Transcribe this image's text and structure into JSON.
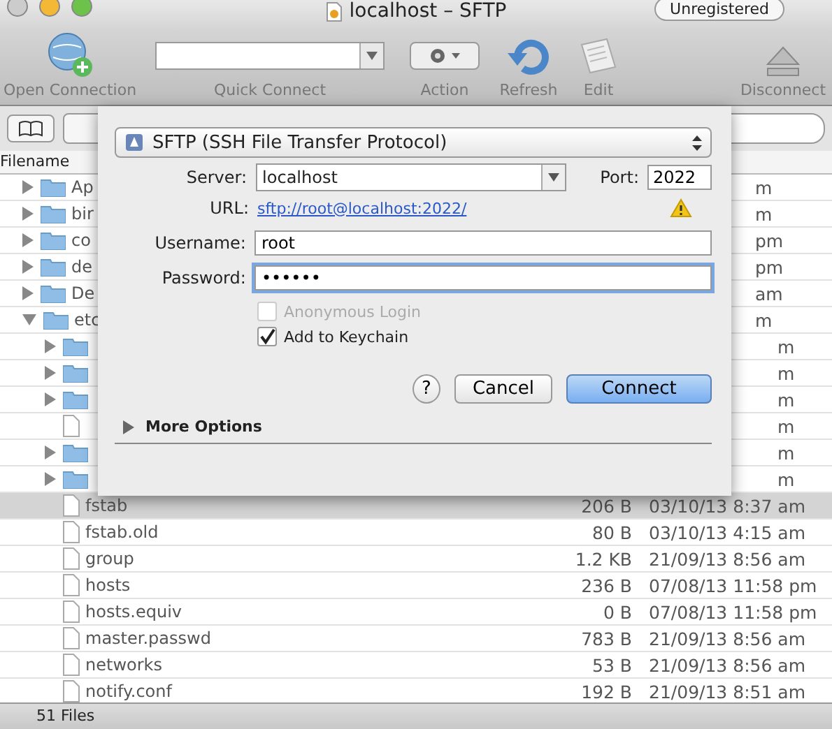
{
  "window": {
    "title": "localhost – SFTP",
    "badge": "Unregistered"
  },
  "toolbar": [
    {
      "kind": "globe",
      "label": "Open Connection"
    },
    {
      "kind": "combo",
      "label": "Quick Connect"
    },
    {
      "kind": "action",
      "label": "Action"
    },
    {
      "kind": "refresh",
      "label": "Refresh"
    },
    {
      "kind": "edit",
      "label": "Edit"
    },
    {
      "kind": "eject",
      "label": "Disconnect"
    }
  ],
  "list_header": "Filename",
  "files": [
    {
      "kind": "folder",
      "name": "Ap",
      "modified": "m",
      "expanded": false,
      "selected": false
    },
    {
      "kind": "folder",
      "name": "bir",
      "modified": "m",
      "expanded": false,
      "selected": false
    },
    {
      "kind": "folder",
      "name": "co",
      "modified": "pm",
      "expanded": false,
      "selected": false
    },
    {
      "kind": "folder",
      "name": "de",
      "modified": "pm",
      "expanded": false,
      "selected": false
    },
    {
      "kind": "folder",
      "name": "De",
      "modified": "am",
      "expanded": false,
      "selected": false
    },
    {
      "kind": "folder",
      "name": "etc",
      "modified": "m",
      "expanded": true,
      "selected": false,
      "children": [
        {
          "kind": "folder",
          "modified": "m",
          "expanded": false,
          "selected": false
        },
        {
          "kind": "folder",
          "modified": "m",
          "expanded": false,
          "selected": false
        },
        {
          "kind": "folder",
          "modified": "m",
          "expanded": false,
          "selected": false
        },
        {
          "kind": "file",
          "modified": "m",
          "selected": false
        },
        {
          "kind": "folder",
          "modified": "m",
          "expanded": false,
          "selected": false
        },
        {
          "kind": "folder",
          "modified": "m",
          "expanded": false,
          "selected": false
        },
        {
          "kind": "file",
          "name": "fstab",
          "size": "206 B",
          "modified": "03/10/13 8:37 am",
          "selected": true
        },
        {
          "kind": "file",
          "name": "fstab.old",
          "size": "80 B",
          "modified": "03/10/13 4:15 am",
          "selected": false
        },
        {
          "kind": "file",
          "name": "group",
          "size": "1.2 KB",
          "modified": "21/09/13 8:56 am",
          "selected": false
        },
        {
          "kind": "file",
          "name": "hosts",
          "size": "236 B",
          "modified": "07/08/13 11:58 pm",
          "selected": false
        },
        {
          "kind": "file",
          "name": "hosts.equiv",
          "size": "0 B",
          "modified": "07/08/13 11:58 pm",
          "selected": false
        },
        {
          "kind": "file",
          "name": "master.passwd",
          "size": "783 B",
          "modified": "21/09/13 8:56 am",
          "selected": false
        },
        {
          "kind": "file",
          "name": "networks",
          "size": "53 B",
          "modified": "21/09/13 8:56 am",
          "selected": false
        },
        {
          "kind": "file",
          "name": "notify.conf",
          "size": "192 B",
          "modified": "21/09/13 8:51 am",
          "selected": false
        }
      ]
    }
  ],
  "status_bar": "51 Files",
  "sheet": {
    "protocol": "SFTP (SSH File Transfer Protocol)",
    "server_label": "Server:",
    "server": "localhost",
    "port_label": "Port:",
    "port": "2022",
    "url_label": "URL:",
    "url": "sftp://root@localhost:2022/",
    "url_warning": true,
    "username_label": "Username:",
    "username": "root",
    "password_label": "Password:",
    "password": "••••••",
    "options": [
      {
        "label": "Anonymous Login",
        "checked": false,
        "disabled": true
      },
      {
        "label": "Add to Keychain",
        "checked": true,
        "disabled": false
      }
    ],
    "help": "?",
    "cancel": "Cancel",
    "connect": "Connect",
    "more_options": "More Options",
    "more_expanded": false
  }
}
